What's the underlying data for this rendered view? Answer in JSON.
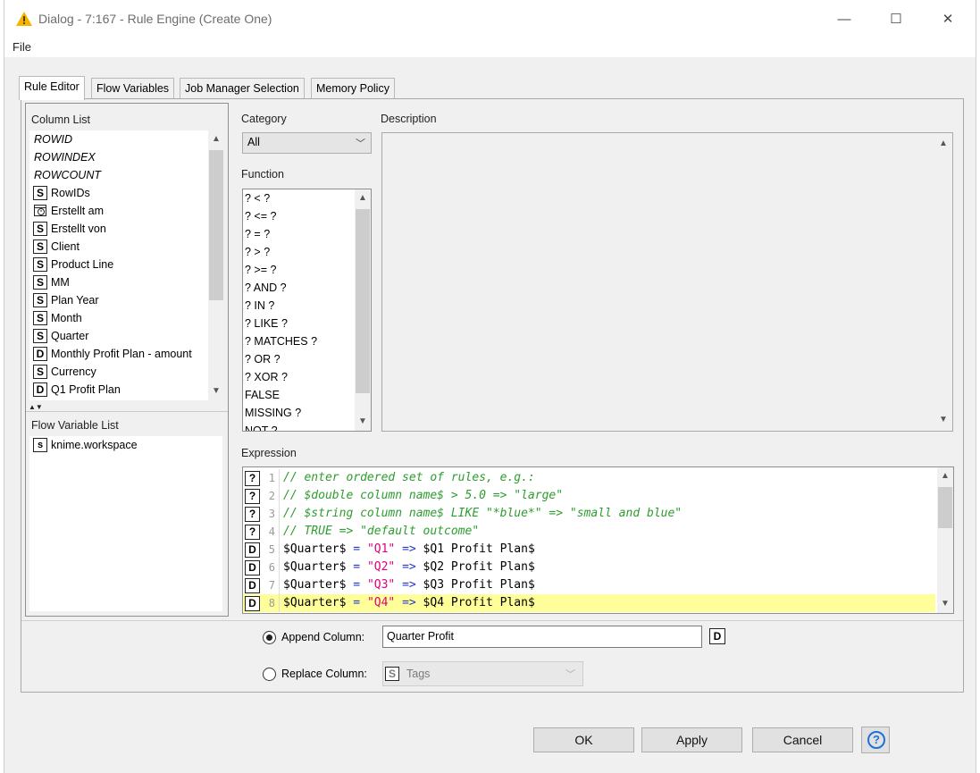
{
  "window": {
    "title": "Dialog - 7:167 - Rule Engine (Create One)",
    "menu_file": "File",
    "minimize": "—",
    "maximize": "☐",
    "close": "✕"
  },
  "tabs": [
    "Rule Editor",
    "Flow Variables",
    "Job Manager Selection",
    "Memory Policy"
  ],
  "column_list": {
    "label": "Column List",
    "special": [
      "ROWID",
      "ROWINDEX",
      "ROWCOUNT"
    ],
    "columns": [
      {
        "type": "S",
        "name": "RowIDs"
      },
      {
        "type": "date",
        "name": "Erstellt am"
      },
      {
        "type": "S",
        "name": "Erstellt von"
      },
      {
        "type": "S",
        "name": "Client"
      },
      {
        "type": "S",
        "name": "Product Line"
      },
      {
        "type": "S",
        "name": "MM"
      },
      {
        "type": "S",
        "name": "Plan Year"
      },
      {
        "type": "S",
        "name": "Month"
      },
      {
        "type": "S",
        "name": "Quarter"
      },
      {
        "type": "D",
        "name": "Monthly Profit Plan - amount"
      },
      {
        "type": "S",
        "name": "Currency"
      },
      {
        "type": "D",
        "name": "Q1 Profit Plan"
      }
    ]
  },
  "flow_variable_list": {
    "label": "Flow Variable List",
    "items": [
      {
        "type": "s",
        "name": "knime.workspace"
      }
    ]
  },
  "category": {
    "label": "Category",
    "value": "All"
  },
  "function": {
    "label": "Function",
    "items": [
      "? < ?",
      "? <= ?",
      "? = ?",
      "? > ?",
      "? >= ?",
      "? AND ?",
      "? IN ?",
      "? LIKE ?",
      "? MATCHES ?",
      "? OR ?",
      "? XOR ?",
      "FALSE",
      "MISSING ?",
      "NOT ?"
    ]
  },
  "description": {
    "label": "Description"
  },
  "expression": {
    "label": "Expression",
    "lines": [
      {
        "badge": "?",
        "no": "1",
        "parts": [
          {
            "c": "comment",
            "t": "// enter ordered set of rules, e.g.:"
          }
        ]
      },
      {
        "badge": "?",
        "no": "2",
        "parts": [
          {
            "c": "comment",
            "t": "// $double column name$ > 5.0 => \"large\""
          }
        ]
      },
      {
        "badge": "?",
        "no": "3",
        "parts": [
          {
            "c": "comment",
            "t": "// $string column name$ LIKE \"*blue*\" => \"small and blue\""
          }
        ]
      },
      {
        "badge": "?",
        "no": "4",
        "parts": [
          {
            "c": "comment",
            "t": "// TRUE => \"default outcome\""
          }
        ]
      },
      {
        "badge": "D",
        "no": "5",
        "parts": [
          {
            "c": "plain",
            "t": "$Quarter$ "
          },
          {
            "c": "op",
            "t": "="
          },
          {
            "c": "plain",
            "t": " "
          },
          {
            "c": "str",
            "t": "\"Q1\""
          },
          {
            "c": "plain",
            "t": " "
          },
          {
            "c": "op",
            "t": "=>"
          },
          {
            "c": "plain",
            "t": " $Q1 Profit Plan$"
          }
        ]
      },
      {
        "badge": "D",
        "no": "6",
        "parts": [
          {
            "c": "plain",
            "t": "$Quarter$ "
          },
          {
            "c": "op",
            "t": "="
          },
          {
            "c": "plain",
            "t": " "
          },
          {
            "c": "str",
            "t": "\"Q2\""
          },
          {
            "c": "plain",
            "t": " "
          },
          {
            "c": "op",
            "t": "=>"
          },
          {
            "c": "plain",
            "t": " $Q2 Profit Plan$"
          }
        ]
      },
      {
        "badge": "D",
        "no": "7",
        "parts": [
          {
            "c": "plain",
            "t": "$Quarter$ "
          },
          {
            "c": "op",
            "t": "="
          },
          {
            "c": "plain",
            "t": " "
          },
          {
            "c": "str",
            "t": "\"Q3\""
          },
          {
            "c": "plain",
            "t": " "
          },
          {
            "c": "op",
            "t": "=>"
          },
          {
            "c": "plain",
            "t": " $Q3 Profit Plan$"
          }
        ]
      },
      {
        "badge": "D",
        "no": "8",
        "highlight": true,
        "parts": [
          {
            "c": "plain",
            "t": "$Quarter$ "
          },
          {
            "c": "op",
            "t": "="
          },
          {
            "c": "plain",
            "t": " "
          },
          {
            "c": "str",
            "t": "\"Q4\""
          },
          {
            "c": "plain",
            "t": " "
          },
          {
            "c": "op",
            "t": "=>"
          },
          {
            "c": "plain",
            "t": " $Q4 Profit Plan$"
          }
        ]
      }
    ]
  },
  "output": {
    "append_label": "Append Column:",
    "append_value": "Quarter Profit",
    "append_type": "D",
    "append_selected": true,
    "replace_label": "Replace Column:",
    "replace_type": "S",
    "replace_value": "Tags"
  },
  "buttons": {
    "ok": "OK",
    "apply": "Apply",
    "cancel": "Cancel",
    "help": "?"
  },
  "colors": {
    "highlight": "#ffff99",
    "comment": "#2e9c2e",
    "string": "#e0007a",
    "operator": "#2437c8",
    "help": "#1d72d8"
  }
}
